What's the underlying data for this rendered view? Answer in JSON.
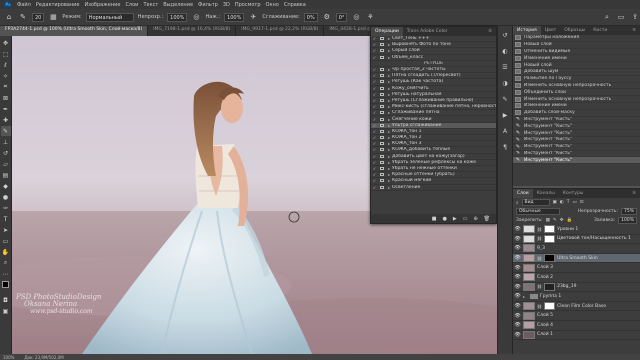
{
  "menu": [
    "Файл",
    "Редактирование",
    "Изображение",
    "Слои",
    "Текст",
    "Выделение",
    "Фильтр",
    "3D",
    "Просмотр",
    "Окно",
    "Справка"
  ],
  "options": {
    "mode_label": "Режим:",
    "mode_value": "Нормальный",
    "opacity_label": "Непрозр.:",
    "opacity_value": "100%",
    "flow_label": "Наж.:",
    "flow_value": "100%",
    "smoothing_label": "Сглаживание:",
    "smoothing_value": "0%",
    "brush_size": "20",
    "angle_value": "0°"
  },
  "tabs": [
    "FP3A2744-1.psd @ 100% (Ultra Smooth Skin, Слой-маска/8)",
    "IMG_7198-1.psd @ 16,4% (RGB/8)",
    "IMG_9917-1.psd @ 22,2% (RGB/8)",
    "IMG_4428-1.psd @ 22,1% (RGB/8)"
  ],
  "watermark": {
    "line1": "PSD PhotoStudioDesign",
    "line2": "Oksana Nerina",
    "line3": "www.psd-studio.com"
  },
  "status": {
    "zoom": "100%",
    "doc": "Док: 23,9M/502,0M"
  },
  "actions_panel": {
    "tabs": [
      "Операции",
      "Trans Adobe Color"
    ],
    "rows": [
      {
        "label": "Свет_Тень +++",
        "type": "action"
      },
      {
        "label": "Выровнять Фото по тоне",
        "type": "action"
      },
      {
        "label": "Серый слой",
        "type": "action"
      },
      {
        "label": "Объем_класс",
        "type": "action"
      },
      {
        "label": "РЕТУШЬ",
        "type": "sep"
      },
      {
        "label": "ч/р простая_2 частоты",
        "type": "action"
      },
      {
        "label": "Пятна сгладить (Т/пересвет)",
        "type": "action"
      },
      {
        "label": "Ретушь (Как частота)",
        "type": "action"
      },
      {
        "label": "Кожу_смягчить",
        "type": "action"
      },
      {
        "label": "Ретушь натуральная",
        "type": "action"
      },
      {
        "label": "Ретушь (Сглаживание правильно)",
        "type": "action"
      },
      {
        "label": "Микс-кисть (сглаживание пятна, неровности)",
        "type": "action"
      },
      {
        "label": "Сглаживание пятна",
        "type": "action"
      },
      {
        "label": "Смягчение кожи",
        "type": "action"
      },
      {
        "label": "Ультра сглаживание",
        "type": "action",
        "selected": true
      },
      {
        "label": "КОЖА_тон 1",
        "type": "action"
      },
      {
        "label": "КОЖА_тон 2",
        "type": "action"
      },
      {
        "label": "КОЖА_тон 3",
        "type": "action"
      },
      {
        "label": "КОЖА_добавить теплые",
        "type": "action"
      },
      {
        "label": "Добавить цвет на кожу(загар)",
        "type": "action"
      },
      {
        "label": "Убрать зеленые рефлексы на коже",
        "type": "action"
      },
      {
        "label": "Убрать не нежные оттенки",
        "type": "action"
      },
      {
        "label": "Красные оттенки (убрать)",
        "type": "action"
      },
      {
        "label": "Красный мягкий",
        "type": "action"
      },
      {
        "label": "Осветление",
        "type": "action"
      }
    ]
  },
  "history_panel": {
    "tabs": [
      "История",
      "Цвет",
      "Образцы",
      "Кисти"
    ],
    "rows": [
      {
        "label": "Параметры наложения",
        "icon": "layer"
      },
      {
        "label": "Новый слой",
        "icon": "layer"
      },
      {
        "label": "Отменить видимые",
        "icon": "layer"
      },
      {
        "label": "Изменение имени",
        "icon": "layer"
      },
      {
        "label": "Новый слой",
        "icon": "layer"
      },
      {
        "label": "Добавить шум",
        "icon": "layer"
      },
      {
        "label": "Размытие по Гауссу",
        "icon": "layer"
      },
      {
        "label": "Изменить основную непрозрачность",
        "icon": "layer"
      },
      {
        "label": "Объединить слои",
        "icon": "layer"
      },
      {
        "label": "Изменить основную непрозрачность",
        "icon": "layer"
      },
      {
        "label": "Изменение имени",
        "icon": "layer"
      },
      {
        "label": "Добавить слой-маску",
        "icon": "layer"
      },
      {
        "label": "Инструмент \"Кисть\"",
        "icon": "brush"
      },
      {
        "label": "Инструмент \"Кисть\"",
        "icon": "brush"
      },
      {
        "label": "Инструмент \"Кисть\"",
        "icon": "brush"
      },
      {
        "label": "Инструмент \"Кисть\"",
        "icon": "brush"
      },
      {
        "label": "Инструмент \"Кисть\"",
        "icon": "brush"
      },
      {
        "label": "Инструмент \"Кисть\"",
        "icon": "brush"
      },
      {
        "label": "Инструмент \"Кисть\"",
        "icon": "brush",
        "selected": true
      }
    ]
  },
  "layers_panel": {
    "tabs": [
      "Слои",
      "Каналы",
      "Контуры"
    ],
    "filter": "Вид",
    "blend_mode": "Обычные",
    "opacity_label": "Непрозрачность:",
    "opacity_value": "75%",
    "lock_label": "Закрепить:",
    "fill_label": "Заливка:",
    "fill_value": "100%",
    "layers": [
      {
        "name": "Уровни 1",
        "kind": "adjust",
        "thumb": "#d0d0d0",
        "mask": "#ffffff"
      },
      {
        "name": "Цветовой тон/Насыщенность 1",
        "kind": "adjust",
        "thumb": "#d0d0d0",
        "mask": "#ffffff"
      },
      {
        "name": "9_3",
        "kind": "layer",
        "thumb": "#9c8a8e"
      },
      {
        "name": "Ultra Smooth Skin",
        "kind": "masked",
        "thumb": "#b79ea0",
        "mask": "#050505",
        "selected": true
      },
      {
        "name": "Слой 3",
        "kind": "layer",
        "thumb": "#a58c90"
      },
      {
        "name": "Слой 2",
        "kind": "layer",
        "thumb": "#b9a6ab"
      },
      {
        "name": "23bg_19",
        "kind": "masked",
        "thumb": "#7e7379",
        "mask": "#222222"
      },
      {
        "name": "Группа 1",
        "kind": "group"
      },
      {
        "name": "Clean Film Color Base",
        "kind": "masked",
        "thumb": "#a09094",
        "mask": "#ffffff"
      },
      {
        "name": "Слой 5",
        "kind": "layer",
        "thumb": "#8f8386"
      },
      {
        "name": "Слой 4",
        "kind": "layer",
        "thumb": "#b2a0a6"
      },
      {
        "name": "Слой 1",
        "kind": "layer",
        "thumb": "#6a5c60"
      }
    ]
  }
}
